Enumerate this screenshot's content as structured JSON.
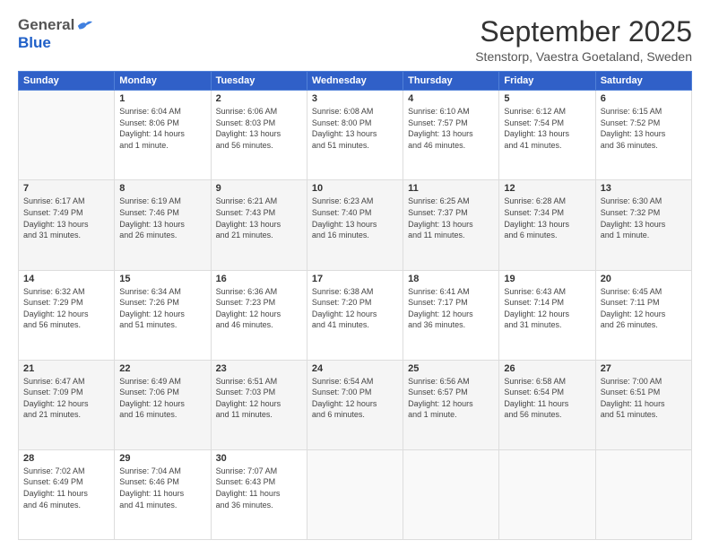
{
  "header": {
    "logo_general": "General",
    "logo_blue": "Blue",
    "month_title": "September 2025",
    "location": "Stenstorp, Vaestra Goetaland, Sweden"
  },
  "days_of_week": [
    "Sunday",
    "Monday",
    "Tuesday",
    "Wednesday",
    "Thursday",
    "Friday",
    "Saturday"
  ],
  "weeks": [
    [
      {
        "day": "",
        "info": ""
      },
      {
        "day": "1",
        "info": "Sunrise: 6:04 AM\nSunset: 8:06 PM\nDaylight: 14 hours\nand 1 minute."
      },
      {
        "day": "2",
        "info": "Sunrise: 6:06 AM\nSunset: 8:03 PM\nDaylight: 13 hours\nand 56 minutes."
      },
      {
        "day": "3",
        "info": "Sunrise: 6:08 AM\nSunset: 8:00 PM\nDaylight: 13 hours\nand 51 minutes."
      },
      {
        "day": "4",
        "info": "Sunrise: 6:10 AM\nSunset: 7:57 PM\nDaylight: 13 hours\nand 46 minutes."
      },
      {
        "day": "5",
        "info": "Sunrise: 6:12 AM\nSunset: 7:54 PM\nDaylight: 13 hours\nand 41 minutes."
      },
      {
        "day": "6",
        "info": "Sunrise: 6:15 AM\nSunset: 7:52 PM\nDaylight: 13 hours\nand 36 minutes."
      }
    ],
    [
      {
        "day": "7",
        "info": "Sunrise: 6:17 AM\nSunset: 7:49 PM\nDaylight: 13 hours\nand 31 minutes."
      },
      {
        "day": "8",
        "info": "Sunrise: 6:19 AM\nSunset: 7:46 PM\nDaylight: 13 hours\nand 26 minutes."
      },
      {
        "day": "9",
        "info": "Sunrise: 6:21 AM\nSunset: 7:43 PM\nDaylight: 13 hours\nand 21 minutes."
      },
      {
        "day": "10",
        "info": "Sunrise: 6:23 AM\nSunset: 7:40 PM\nDaylight: 13 hours\nand 16 minutes."
      },
      {
        "day": "11",
        "info": "Sunrise: 6:25 AM\nSunset: 7:37 PM\nDaylight: 13 hours\nand 11 minutes."
      },
      {
        "day": "12",
        "info": "Sunrise: 6:28 AM\nSunset: 7:34 PM\nDaylight: 13 hours\nand 6 minutes."
      },
      {
        "day": "13",
        "info": "Sunrise: 6:30 AM\nSunset: 7:32 PM\nDaylight: 13 hours\nand 1 minute."
      }
    ],
    [
      {
        "day": "14",
        "info": "Sunrise: 6:32 AM\nSunset: 7:29 PM\nDaylight: 12 hours\nand 56 minutes."
      },
      {
        "day": "15",
        "info": "Sunrise: 6:34 AM\nSunset: 7:26 PM\nDaylight: 12 hours\nand 51 minutes."
      },
      {
        "day": "16",
        "info": "Sunrise: 6:36 AM\nSunset: 7:23 PM\nDaylight: 12 hours\nand 46 minutes."
      },
      {
        "day": "17",
        "info": "Sunrise: 6:38 AM\nSunset: 7:20 PM\nDaylight: 12 hours\nand 41 minutes."
      },
      {
        "day": "18",
        "info": "Sunrise: 6:41 AM\nSunset: 7:17 PM\nDaylight: 12 hours\nand 36 minutes."
      },
      {
        "day": "19",
        "info": "Sunrise: 6:43 AM\nSunset: 7:14 PM\nDaylight: 12 hours\nand 31 minutes."
      },
      {
        "day": "20",
        "info": "Sunrise: 6:45 AM\nSunset: 7:11 PM\nDaylight: 12 hours\nand 26 minutes."
      }
    ],
    [
      {
        "day": "21",
        "info": "Sunrise: 6:47 AM\nSunset: 7:09 PM\nDaylight: 12 hours\nand 21 minutes."
      },
      {
        "day": "22",
        "info": "Sunrise: 6:49 AM\nSunset: 7:06 PM\nDaylight: 12 hours\nand 16 minutes."
      },
      {
        "day": "23",
        "info": "Sunrise: 6:51 AM\nSunset: 7:03 PM\nDaylight: 12 hours\nand 11 minutes."
      },
      {
        "day": "24",
        "info": "Sunrise: 6:54 AM\nSunset: 7:00 PM\nDaylight: 12 hours\nand 6 minutes."
      },
      {
        "day": "25",
        "info": "Sunrise: 6:56 AM\nSunset: 6:57 PM\nDaylight: 12 hours\nand 1 minute."
      },
      {
        "day": "26",
        "info": "Sunrise: 6:58 AM\nSunset: 6:54 PM\nDaylight: 11 hours\nand 56 minutes."
      },
      {
        "day": "27",
        "info": "Sunrise: 7:00 AM\nSunset: 6:51 PM\nDaylight: 11 hours\nand 51 minutes."
      }
    ],
    [
      {
        "day": "28",
        "info": "Sunrise: 7:02 AM\nSunset: 6:49 PM\nDaylight: 11 hours\nand 46 minutes."
      },
      {
        "day": "29",
        "info": "Sunrise: 7:04 AM\nSunset: 6:46 PM\nDaylight: 11 hours\nand 41 minutes."
      },
      {
        "day": "30",
        "info": "Sunrise: 7:07 AM\nSunset: 6:43 PM\nDaylight: 11 hours\nand 36 minutes."
      },
      {
        "day": "",
        "info": ""
      },
      {
        "day": "",
        "info": ""
      },
      {
        "day": "",
        "info": ""
      },
      {
        "day": "",
        "info": ""
      }
    ]
  ]
}
